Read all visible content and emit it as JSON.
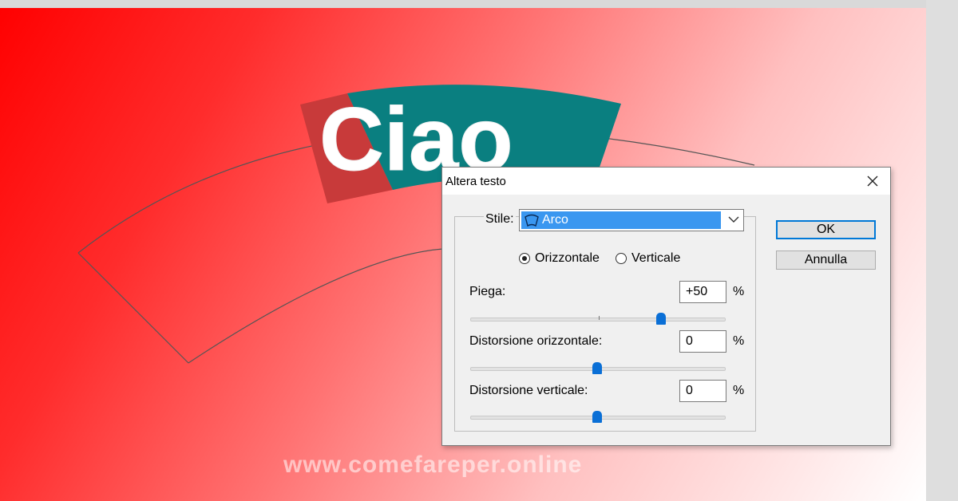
{
  "canvas": {
    "art_text": "Ciao",
    "watermark": "www.comefareper.online",
    "colors": {
      "gradient_start": "#ff0000",
      "gradient_end": "#ffffff",
      "text_band_red": "#c83a3a",
      "text_band_teal": "#0a7f80"
    }
  },
  "dialog": {
    "title": "Altera testo",
    "close_icon": "close-icon",
    "style": {
      "label": "Stile:",
      "value": "Arco",
      "icon": "arc-warp-icon"
    },
    "orientation": {
      "options": [
        "Orizzontale",
        "Verticale"
      ],
      "selected": "Orizzontale"
    },
    "bend": {
      "label": "Piega:",
      "value": "+50",
      "unit": "%",
      "level": 0.75
    },
    "h_distortion": {
      "label": "Distorsione orizzontale:",
      "value": "0",
      "unit": "%",
      "level": 0.5
    },
    "v_distortion": {
      "label": "Distorsione verticale:",
      "value": "0",
      "unit": "%",
      "level": 0.5
    },
    "buttons": {
      "ok": "OK",
      "cancel": "Annulla"
    },
    "accent_color": "#0078d7"
  }
}
